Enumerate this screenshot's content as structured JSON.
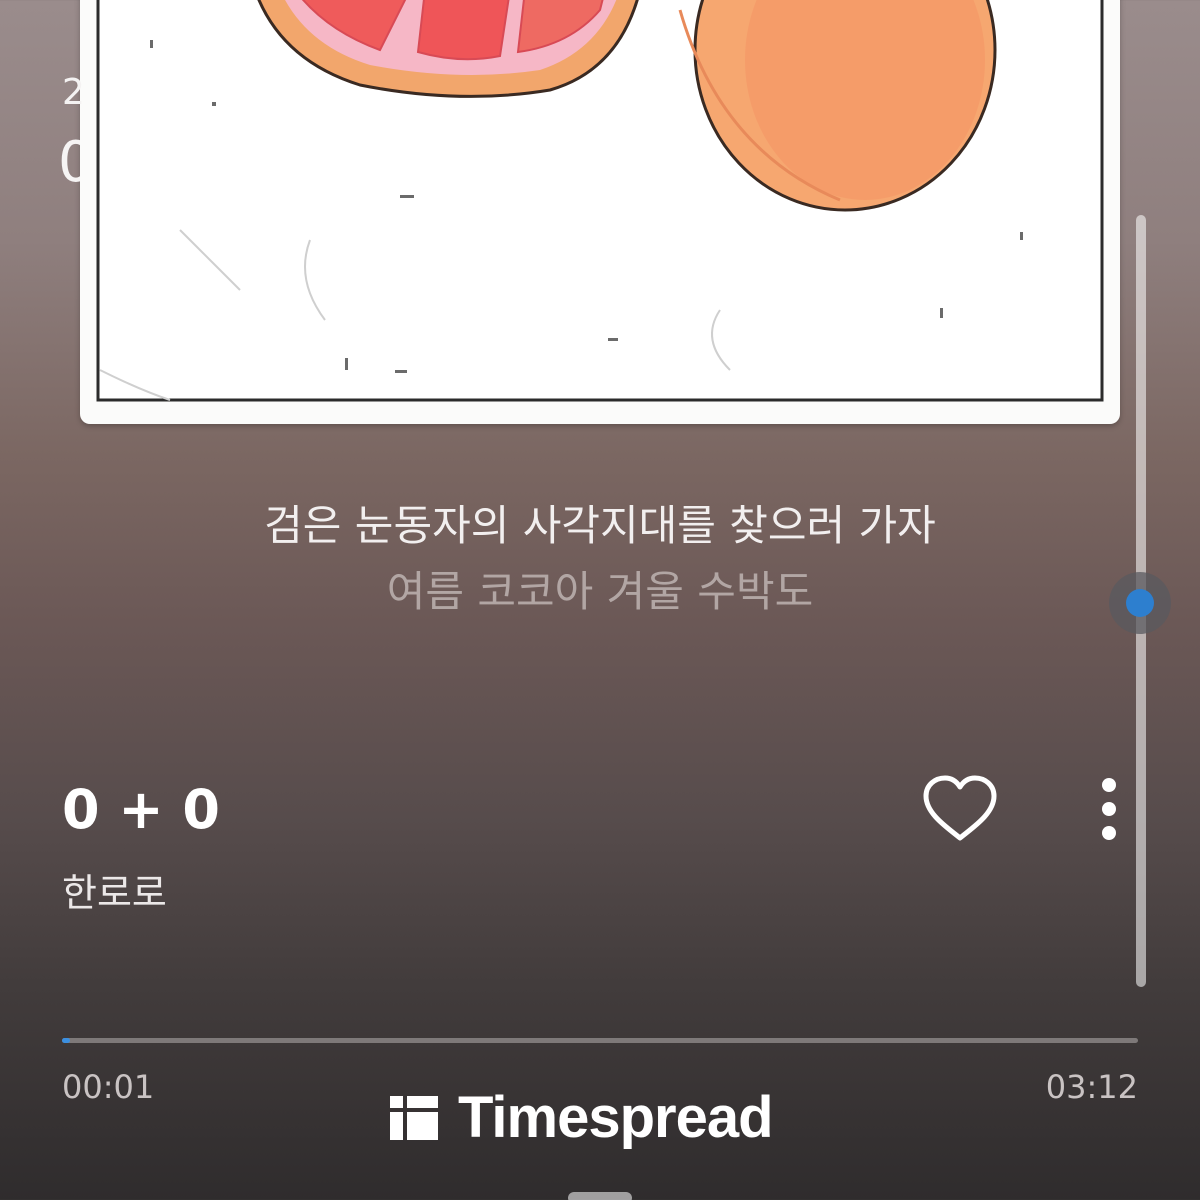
{
  "status": {
    "date_partial": "2",
    "time_partial": "0"
  },
  "lyrics": {
    "current": "검은 눈동자의 사각지대를 찾으러 가자",
    "next": "여름 코코아 겨울 수박도"
  },
  "track": {
    "title": "0 + 0",
    "artist": "한로로",
    "elapsed": "00:01",
    "duration": "03:12",
    "progress_fraction": 0.005
  },
  "icons": {
    "like": "heart-outline-icon",
    "more": "more-vertical-icon",
    "watermark": "timespread-logo-icon"
  },
  "watermark": {
    "text": "Timespread"
  },
  "colors": {
    "accent": "#3b8fe0",
    "scroll_dot": "#2d7fcf"
  }
}
